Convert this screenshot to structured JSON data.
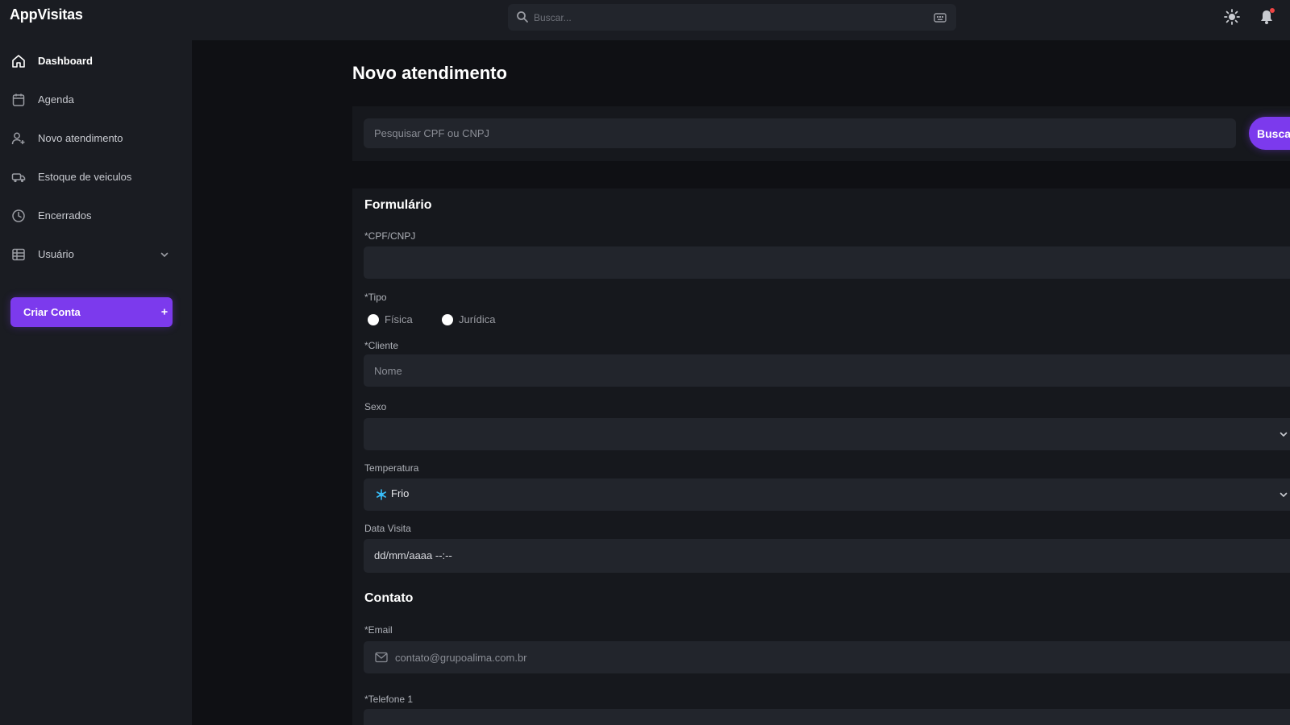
{
  "app": {
    "brand": "AppVisitas"
  },
  "topbar": {
    "search_placeholder": "Buscar...",
    "icons": [
      "search-icon",
      "keyboard-icon",
      "sun-icon",
      "bell-icon"
    ]
  },
  "sidebar": {
    "items": [
      {
        "label": "Dashboard",
        "icon": "home-icon",
        "active": true
      },
      {
        "label": "Agenda",
        "icon": "calendar-icon",
        "active": false
      },
      {
        "label": "Novo atendimento",
        "icon": "user-add-icon",
        "active": false
      },
      {
        "label": "Estoque de veiculos",
        "icon": "car-icon",
        "active": false
      },
      {
        "label": "Encerrados",
        "icon": "clock-icon",
        "active": false
      },
      {
        "label": "Usuário",
        "icon": "table-icon",
        "active": false
      }
    ],
    "cta_label": "Criar Conta"
  },
  "main": {
    "title": "Novo atendimento",
    "search": {
      "placeholder": "Pesquisar CPF ou CNPJ",
      "button_label": "Buscar"
    },
    "form": {
      "title": "Formulário",
      "cpf_label": "*CPF/CNPJ",
      "cpf_value": "",
      "tipo_label": "*Tipo",
      "tipo_options": [
        "Física",
        "Jurídica"
      ],
      "cliente_label": "*Cliente",
      "cliente_placeholder": "Nome",
      "sexo_label": "Sexo",
      "sexo_value": "",
      "temperatura_label": "Temperatura",
      "temperatura_value": "Frio",
      "data_visita_label": "Data Visita",
      "data_visita_value": "dd/mm/aaaa --:--"
    },
    "contato": {
      "title": "Contato",
      "email_label": "*Email",
      "email_placeholder": "contato@grupoalima.com.br",
      "telefone_label": "*Telefone 1"
    }
  },
  "colors": {
    "accent": "#7c3aed",
    "background": "#0f1014",
    "panel": "#1a1c22",
    "field": "#22252c",
    "notification": "#ef4444"
  }
}
